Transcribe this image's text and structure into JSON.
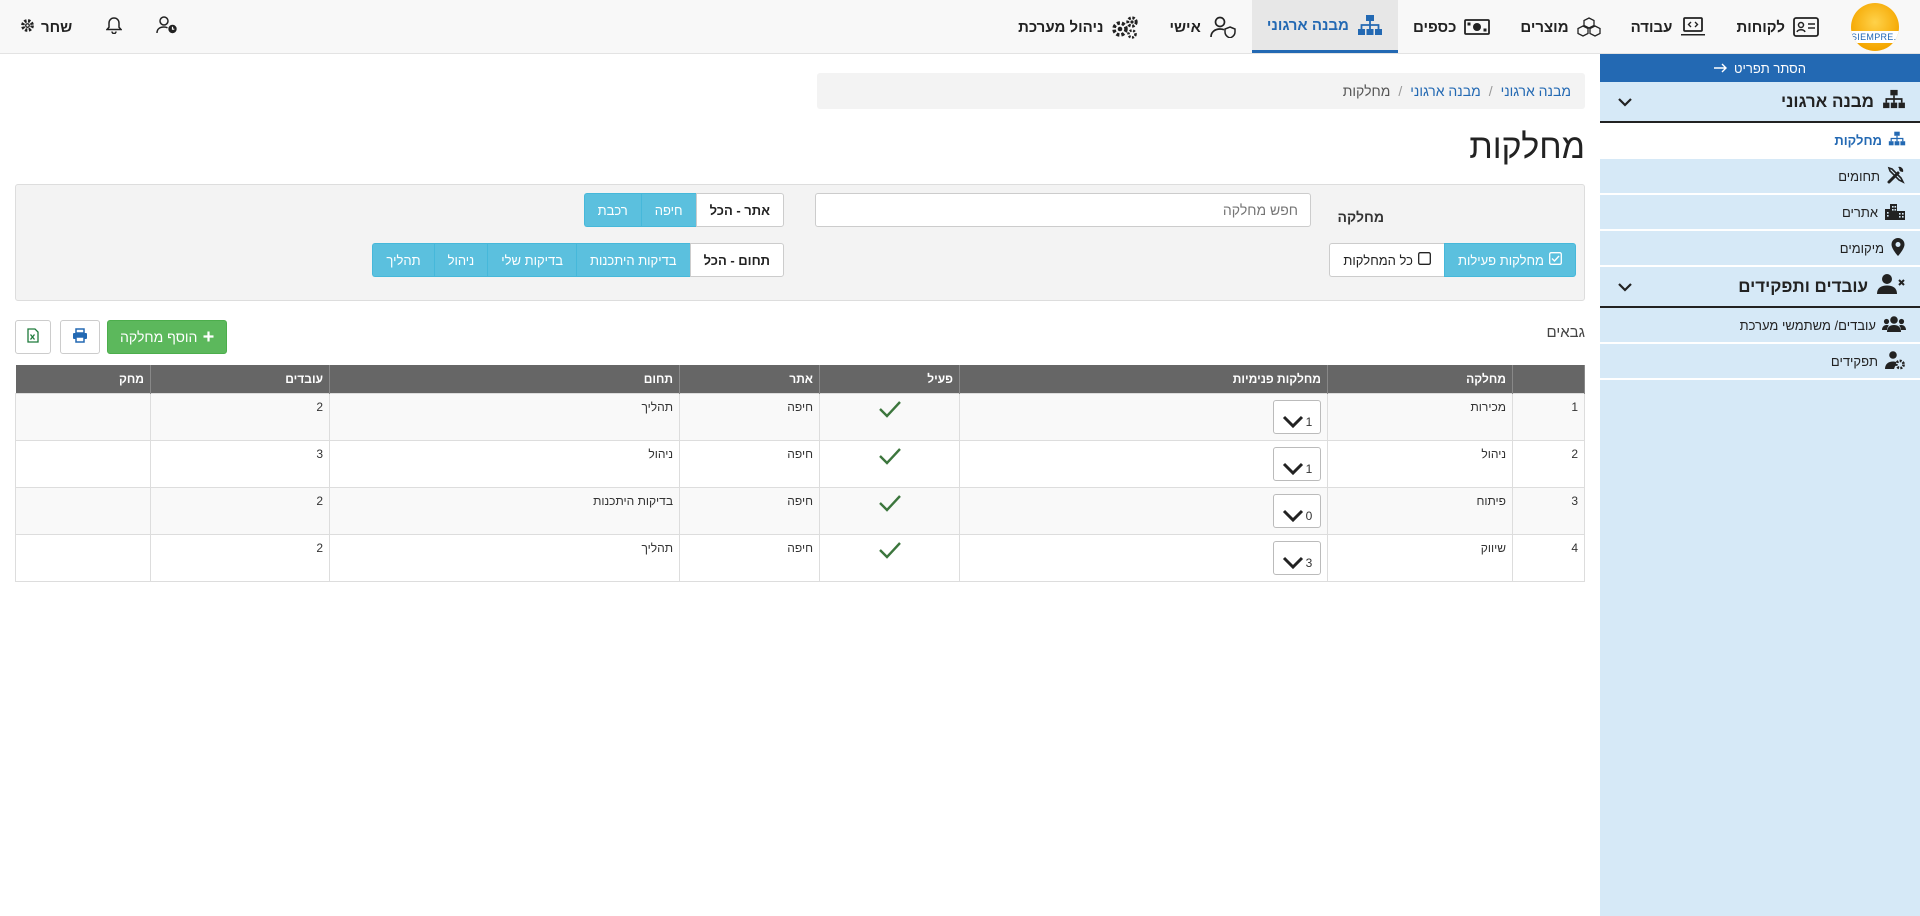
{
  "nav": {
    "logo_text": "SIEMPRE...",
    "items": [
      {
        "label": "לקוחות"
      },
      {
        "label": "עבודה"
      },
      {
        "label": "מוצרים"
      },
      {
        "label": "כספים"
      },
      {
        "label": "מבנה ארגוני"
      },
      {
        "label": "אישי"
      },
      {
        "label": "ניהול מערכת"
      }
    ],
    "user_name": "שחר"
  },
  "sidebar": {
    "hide_menu": "הסתר תפריט",
    "group1": {
      "title": "מבנה ארגוני",
      "items": [
        {
          "label": "מחלקות"
        },
        {
          "label": "תחומים"
        },
        {
          "label": "אתרים"
        },
        {
          "label": "מיקומים"
        }
      ]
    },
    "group2": {
      "title": "עובדים ותפקידים",
      "items": [
        {
          "label": "עובדים/ משתמשי מערכת"
        },
        {
          "label": "תפקידים"
        }
      ]
    }
  },
  "breadcrumb": {
    "root": "מבנה ארגוני",
    "mid": "מבנה ארגוני",
    "current": "מחלקות"
  },
  "page_title": "מחלקות",
  "filters": {
    "department_label": "מחלקה",
    "search_placeholder": "חפש מחלקה",
    "site": {
      "all": "אתר - הכל",
      "options": [
        "חיפה",
        "רכבת"
      ]
    },
    "active": {
      "active_label": "מחלקות פעילות",
      "all_label": "כל המחלקות"
    },
    "domain": {
      "all": "תחום - הכל",
      "options": [
        "בדיקות היתכנות",
        "בדיקות שלי",
        "ניהול",
        "תהליך"
      ]
    }
  },
  "gabaim_label": "גבאים",
  "add_button": "הוסף מחלקה",
  "table": {
    "headers": {
      "num": "",
      "department": "מחלקה",
      "inner": "מחלקות פנימיות",
      "active": "פעיל",
      "site": "אתר",
      "domain": "תחום",
      "employees": "עובדים",
      "delete": "מחק"
    },
    "rows": [
      {
        "num": "1",
        "department": "מכירות",
        "inner": "1",
        "site": "חיפה",
        "domain": "תהליך",
        "employees": "2"
      },
      {
        "num": "2",
        "department": "ניהול",
        "inner": "1",
        "site": "חיפה",
        "domain": "ניהול",
        "employees": "3"
      },
      {
        "num": "3",
        "department": "פיתוח",
        "inner": "0",
        "site": "חיפה",
        "domain": "בדיקות היתכנות",
        "employees": "2"
      },
      {
        "num": "4",
        "department": "שיווק",
        "inner": "3",
        "site": "חיפה",
        "domain": "תהליך",
        "employees": "2"
      }
    ]
  },
  "colors": {
    "accent": "#2369b3",
    "info": "#5bc0de",
    "success": "#5cb85c",
    "check": "#3c763d",
    "sidebar_bg": "#d6e9f7"
  }
}
